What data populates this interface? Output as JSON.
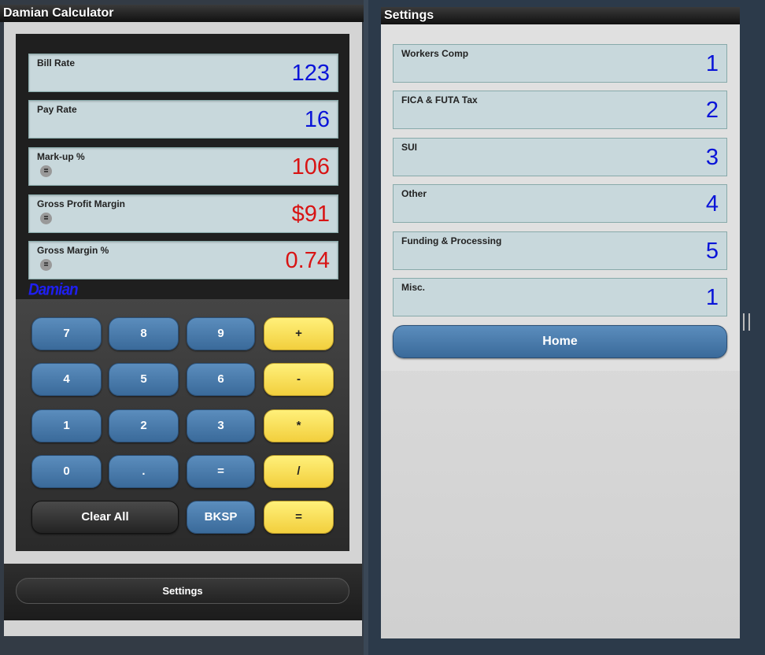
{
  "left": {
    "title": "Damian Calculator",
    "fields": [
      {
        "label": "Bill Rate",
        "value": "123",
        "color": "blue",
        "has_eq": false
      },
      {
        "label": "Pay Rate",
        "value": "16",
        "color": "blue",
        "has_eq": false
      },
      {
        "label": "Mark-up %",
        "value": "106",
        "color": "red",
        "has_eq": true
      },
      {
        "label": "Gross Profit Margin",
        "value": "$91",
        "color": "red",
        "has_eq": true
      },
      {
        "label": "Gross Margin %",
        "value": "0.74",
        "color": "red",
        "has_eq": true
      }
    ],
    "eq_symbol": "=",
    "brand": "Damian",
    "keys": {
      "k7": "7",
      "k8": "8",
      "k9": "9",
      "plus": "+",
      "k4": "4",
      "k5": "5",
      "k6": "6",
      "minus": "-",
      "k1": "1",
      "k2": "2",
      "k3": "3",
      "multiply": "*",
      "k0": "0",
      "dot": ".",
      "equals_blue": "=",
      "divide": "/",
      "clear": "Clear All",
      "bksp": "BKSP",
      "equals_yellow": "="
    },
    "settings_label": "Settings"
  },
  "right": {
    "title": "Settings",
    "fields": [
      {
        "label": "Workers Comp",
        "value": "1"
      },
      {
        "label": "FICA & FUTA Tax",
        "value": "2"
      },
      {
        "label": "SUI",
        "value": "3"
      },
      {
        "label": "Other",
        "value": "4"
      },
      {
        "label": "Funding & Processing",
        "value": "5"
      },
      {
        "label": "Misc.",
        "value": "1"
      }
    ],
    "home_label": "Home"
  },
  "colors": {
    "blue_value": "#0a14d8",
    "red_value": "#d81414",
    "button_blue": "#4a7aab",
    "button_yellow": "#f8e05a"
  }
}
